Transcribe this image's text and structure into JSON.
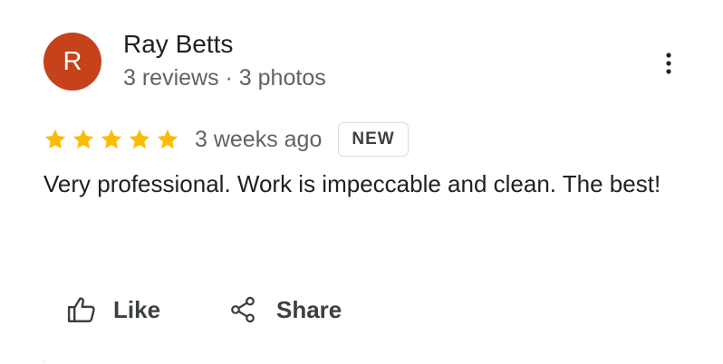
{
  "reviewer": {
    "initial": "R",
    "name": "Ray Betts",
    "meta": "3 reviews · 3 photos",
    "avatar_color": "#c5421a"
  },
  "review": {
    "rating": 5,
    "rating_max": 5,
    "date": "3 weeks ago",
    "badge": "NEW",
    "text": "Very professional.  Work is impeccable and clean.  The best!"
  },
  "actions": {
    "like_label": "Like",
    "share_label": "Share"
  },
  "icons": {
    "more": "more-vert-icon",
    "star": "star-icon",
    "like": "thumb-up-icon",
    "share": "share-icon"
  },
  "colors": {
    "star": "#fbbc04",
    "primary_text": "#202124",
    "secondary_text": "#5f6368"
  }
}
